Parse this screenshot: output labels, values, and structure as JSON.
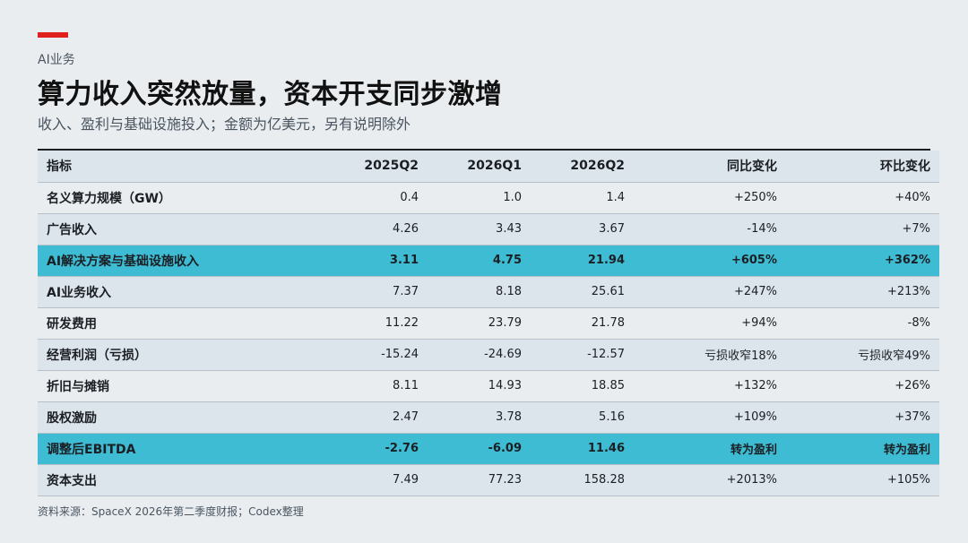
{
  "header": {
    "kicker": "AI业务",
    "title": "算力收入突然放量，资本开支同步激增",
    "subtitle": "收入、盈利与基础设施投入；金额为亿美元，另有说明除外"
  },
  "table": {
    "columns": [
      "指标",
      "2025Q2",
      "2026Q1",
      "2026Q2",
      "同比变化",
      "环比变化"
    ],
    "rows": [
      {
        "cells": [
          "名义算力规模（GW）",
          "0.4",
          "1.0",
          "1.4",
          "+250%",
          "+40%"
        ],
        "highlight": false
      },
      {
        "cells": [
          "广告收入",
          "4.26",
          "3.43",
          "3.67",
          "-14%",
          "+7%"
        ],
        "highlight": false
      },
      {
        "cells": [
          "AI解决方案与基础设施收入",
          "3.11",
          "4.75",
          "21.94",
          "+605%",
          "+362%"
        ],
        "highlight": true
      },
      {
        "cells": [
          "AI业务收入",
          "7.37",
          "8.18",
          "25.61",
          "+247%",
          "+213%"
        ],
        "highlight": false
      },
      {
        "cells": [
          "研发费用",
          "11.22",
          "23.79",
          "21.78",
          "+94%",
          "-8%"
        ],
        "highlight": false
      },
      {
        "cells": [
          "经营利润（亏损）",
          "-15.24",
          "-24.69",
          "-12.57",
          "亏损收窄18%",
          "亏损收窄49%"
        ],
        "highlight": false
      },
      {
        "cells": [
          "折旧与摊销",
          "8.11",
          "14.93",
          "18.85",
          "+132%",
          "+26%"
        ],
        "highlight": false
      },
      {
        "cells": [
          "股权激励",
          "2.47",
          "3.78",
          "5.16",
          "+109%",
          "+37%"
        ],
        "highlight": false
      },
      {
        "cells": [
          "调整后EBITDA",
          "-2.76",
          "-6.09",
          "11.46",
          "转为盈利",
          "转为盈利"
        ],
        "highlight": true
      },
      {
        "cells": [
          "资本支出",
          "7.49",
          "77.23",
          "158.28",
          "+2013%",
          "+105%"
        ],
        "highlight": false
      }
    ]
  },
  "footer": {
    "source": "资料来源：SpaceX 2026年第二季度财报；Codex整理"
  },
  "colors": {
    "accent": "#e0201c",
    "highlight": "#3dbcd3",
    "background": "#e9edf0",
    "band": "#dde5ec"
  }
}
